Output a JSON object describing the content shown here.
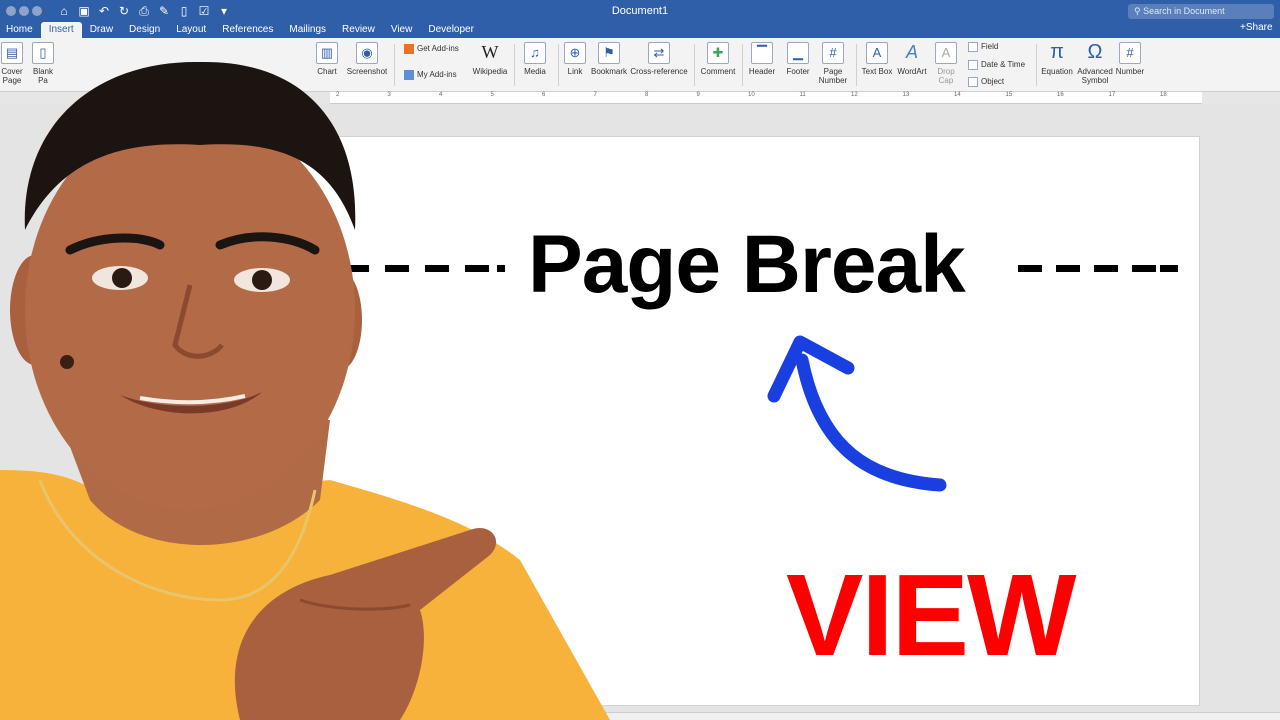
{
  "window": {
    "title": "Document1",
    "search_placeholder": "Search in Document",
    "share_label": "Share"
  },
  "tabs": [
    {
      "label": "Home"
    },
    {
      "label": "Insert",
      "active": true
    },
    {
      "label": "Draw"
    },
    {
      "label": "Design"
    },
    {
      "label": "Layout"
    },
    {
      "label": "References"
    },
    {
      "label": "Mailings"
    },
    {
      "label": "Review"
    },
    {
      "label": "View"
    },
    {
      "label": "Developer"
    }
  ],
  "ribbon": {
    "cover_page": "Cover Page",
    "blank_page": "Blank Pa",
    "chart": "Chart",
    "screenshot": "Screenshot",
    "get_addins": "Get Add-ins",
    "my_addins": "My Add-ins",
    "wikipedia": "Wikipedia",
    "media": "Media",
    "link": "Link",
    "bookmark": "Bookmark",
    "cross_reference": "Cross-reference",
    "comment": "Comment",
    "header": "Header",
    "footer": "Footer",
    "page_number": "Page Number",
    "text_box": "Text Box",
    "wordart": "WordArt",
    "drop_cap": "Drop Cap",
    "field": "Field",
    "date_time": "Date & Time",
    "object": "Object",
    "equation": "Equation",
    "advanced_symbol": "Advanced Symbol",
    "number": "Number"
  },
  "ruler_ticks": [
    "2",
    "3",
    "4",
    "5",
    "6",
    "7",
    "8",
    "9",
    "10",
    "11",
    "12",
    "13",
    "14",
    "15",
    "16",
    "17",
    "18"
  ],
  "document": {
    "page_break_text": "Page Break",
    "overlay_text": "VIEW"
  },
  "colors": {
    "title_bar": "#2f5fa8",
    "arrow": "#1a3fe0",
    "overlay_text": "#ff0000",
    "shirt": "#f7b23b"
  }
}
